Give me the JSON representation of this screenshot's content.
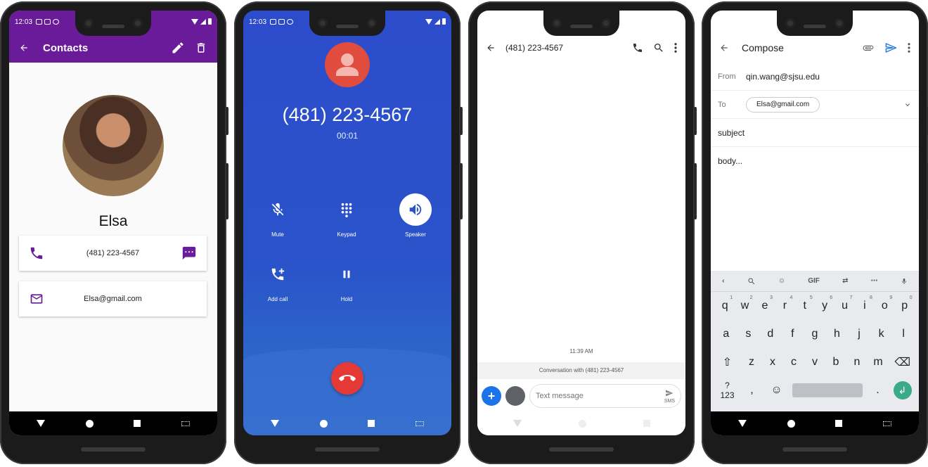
{
  "contacts": {
    "status_time": "12:03",
    "title": "Contacts",
    "name": "Elsa",
    "phone": "(481) 223-4567",
    "email": "Elsa@gmail.com",
    "accent": "#6a1b9a"
  },
  "call": {
    "status_time": "12:03",
    "number": "(481) 223-4567",
    "timer": "00:01",
    "controls": {
      "mute": "Mute",
      "keypad": "Keypad",
      "speaker": "Speaker",
      "add_call": "Add call",
      "hold": "Hold"
    }
  },
  "messages": {
    "title": "(481) 223-4567",
    "timestamp": "11:39 AM",
    "conversation_with": "Conversation with (481) 223-4567",
    "placeholder": "Text message",
    "sms_label": "SMS"
  },
  "compose": {
    "title": "Compose",
    "from_label": "From",
    "from_value": "qin.wang@sjsu.edu",
    "to_label": "To",
    "to_chip": "Elsa@gmail.com",
    "subject": "subject",
    "body": "body...",
    "keyboard": {
      "gif": "GIF",
      "row1": [
        "q",
        "w",
        "e",
        "r",
        "t",
        "y",
        "u",
        "i",
        "o",
        "p"
      ],
      "row1_nums": [
        "1",
        "2",
        "3",
        "4",
        "5",
        "6",
        "7",
        "8",
        "9",
        "0"
      ],
      "row2": [
        "a",
        "s",
        "d",
        "f",
        "g",
        "h",
        "j",
        "k",
        "l"
      ],
      "row3": [
        "z",
        "x",
        "c",
        "v",
        "b",
        "n",
        "m"
      ],
      "sym": "?123",
      "comma": ",",
      "period": "."
    }
  }
}
